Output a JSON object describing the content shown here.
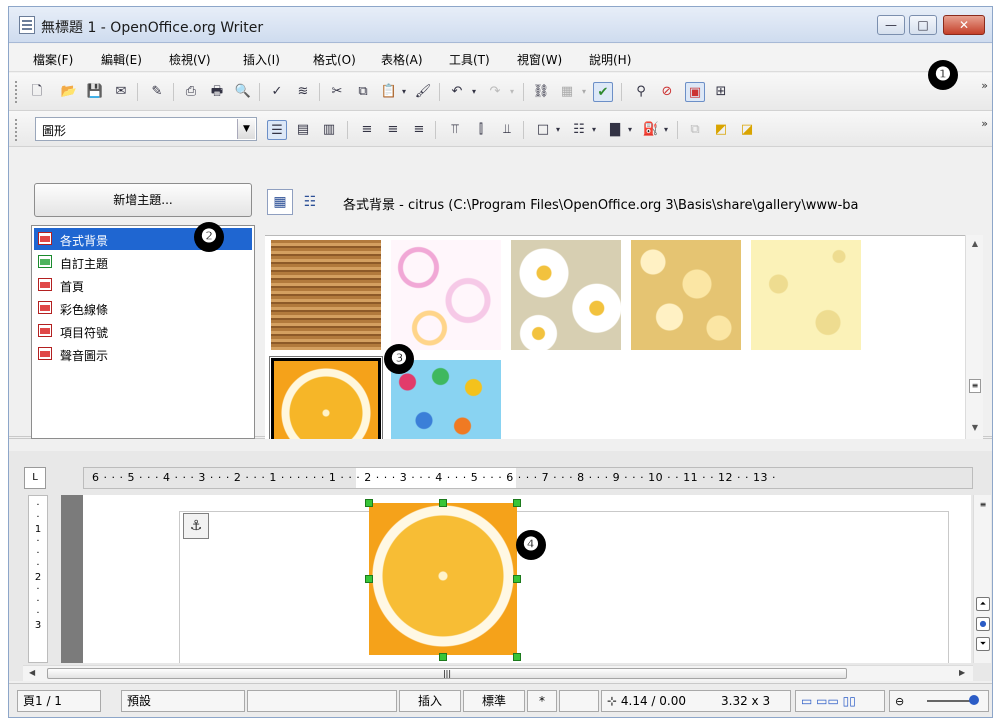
{
  "window": {
    "title": "無標題 1 - OpenOffice.org Writer",
    "controls": {
      "minimize": "—",
      "maximize": "□",
      "close": "✕"
    }
  },
  "menu": [
    "檔案(F)",
    "編輯(E)",
    "檢視(V)",
    "插入(I)",
    "格式(O)",
    "表格(A)",
    "工具(T)",
    "視窗(W)",
    "說明(H)"
  ],
  "toolbar": {
    "overflow": "»",
    "style_select": "圖形"
  },
  "gallery": {
    "new_theme_button": "新增主題...",
    "themes": [
      "各式背景",
      "自訂主題",
      "首頁",
      "彩色線條",
      "項目符號",
      "聲音圖示"
    ],
    "active_theme": "各式背景",
    "path": "各式背景 - citrus (C:\\Program Files\\OpenOffice.org 3\\Basis\\share\\gallery\\www-ba",
    "view_icon_label": "▦",
    "view_detail_label": "☷",
    "thumbnails": [
      "wood-texture",
      "pink-circles",
      "daisies",
      "popcorn",
      "cheese",
      "citrus",
      "candy-dots"
    ],
    "selected_thumbnail": "citrus"
  },
  "ruler": {
    "horizontal": "6 · · · 5 · · · 4 · · · 3 · · · 2 · · · 1 · · ·   · · · 1 · · · 2 · · · 3 · · · 4 · · · 5 · · · 6 · · · 7 · · · 8 · · · 9 · · · 10 · · 11 · · 12 · · 13 ·",
    "vertical": "·\n·\n1\n·\n·\n·\n2\n·\n·\n·\n3",
    "corner": "L"
  },
  "statusbar": {
    "page": "頁1 / 1",
    "style": "預設",
    "empty1": "",
    "insert_mode": "插入",
    "selection_mode": "標準",
    "modified": "*",
    "empty2": "",
    "position": "⊹ 4.14 / 0.00",
    "size": "3.32 x 3",
    "view_layouts": "▭ ▭▭ ▯▯"
  },
  "callouts": [
    "❶",
    "❷",
    "❸",
    "❹"
  ],
  "colors": {
    "selection": "#1f66d1",
    "handles": "#38c538",
    "close_button": "#c4402a"
  }
}
